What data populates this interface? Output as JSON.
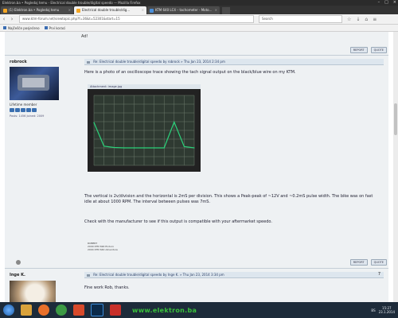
{
  "window": {
    "title": "Elektron.ba • Pogledaj temu - Electrical double trouble/digital speedo — Mozilla Firefox",
    "controls": [
      "–",
      "□",
      "×"
    ]
  },
  "tabs": [
    {
      "label": "(1) Elektron.ba • Pogledaj temu",
      "icon": "forum-favicon",
      "active": false
    },
    {
      "label": "Electrical double trouble/dig...",
      "icon": "forum-favicon",
      "active": true
    },
    {
      "label": "KTM 640 LC4 – tachometer - Moto...",
      "icon": "page-favicon",
      "active": false
    }
  ],
  "nav": {
    "url": "www.ktm-forum.net/viewtopic.php?f=36&t=52301&start=15",
    "search_placeholder": "Search",
    "icons": [
      "star-icon",
      "download-icon",
      "home-icon",
      "menu-icon"
    ]
  },
  "bookmarks": [
    {
      "label": "Najčešće posjećeno"
    },
    {
      "label": "Prvi koraci"
    }
  ],
  "previous_post_tail": "Ad!",
  "buttons": {
    "report": "REPORT",
    "quote": "QUOTE",
    "top": "TOP"
  },
  "post1": {
    "author": "robrock",
    "rank": "Lifetime member",
    "meta": "Posts: 1456  Joined: 2009",
    "subject": "Re: Electrical double trouble/digital speedo",
    "date": "by robrock » Thu Jan 23, 2014 2:34 pm",
    "number": "",
    "text_intro": "Here is a photo of an oscilloscope trace showing the tach signal output on the black/blue wire on my KTM.",
    "scope_caption": "Attachment: image.jpg",
    "text_main": "The vertical is 2v/division and the horizontal is 2mS per division. This shows a Peak-peak of ~12V and ~0.2mS pulse width. The bike was on fast idle at about 1000 RPM. The interval between pulses was 7mS.",
    "text_advice": "Check with the manufacturer to see if this output is compatible with your aftermarket speedo.",
    "signature": [
      "ROBERT",
      "2009 KTM 690 Enduro",
      "2004 KTM 640 Adventure"
    ]
  },
  "post2": {
    "author": "Inge K.",
    "subject": "Re: Electrical double trouble/digital speedo",
    "date": "by Inge K. » Thu Jan 23, 2014 3:34 pm",
    "number": "7",
    "text": "Fine work Rob, thanks."
  },
  "taskbar": {
    "watermark": "www.elektron.ba",
    "apps": [
      "windows-start-icon",
      "explorer-icon",
      "firefox-icon",
      "chrome-icon",
      "media-player-icon",
      "photoshop-icon",
      "pdf-icon"
    ],
    "lang": "BS",
    "time": "15:27",
    "date": "23.1.2014"
  },
  "colors": {
    "scope_trace": "#2bd17a",
    "scope_grid": "#6b7a6b",
    "watermark": "#39c13b",
    "taskbar": "#1d2b3a"
  },
  "chart_data": {
    "type": "line",
    "title": "",
    "xlabel": "",
    "ylabel": "",
    "x": [
      0,
      2,
      4,
      6,
      8,
      10,
      12,
      14,
      16,
      18,
      20
    ],
    "series": [
      {
        "values": [
          5.8,
          0.4,
          0.1,
          0.0,
          0.0,
          0.0,
          0.0,
          0.0,
          5.9,
          0.3,
          0.0
        ]
      }
    ],
    "xlim": [
      0,
      20
    ],
    "ylim": [
      -4,
      12
    ],
    "grid": true
  }
}
